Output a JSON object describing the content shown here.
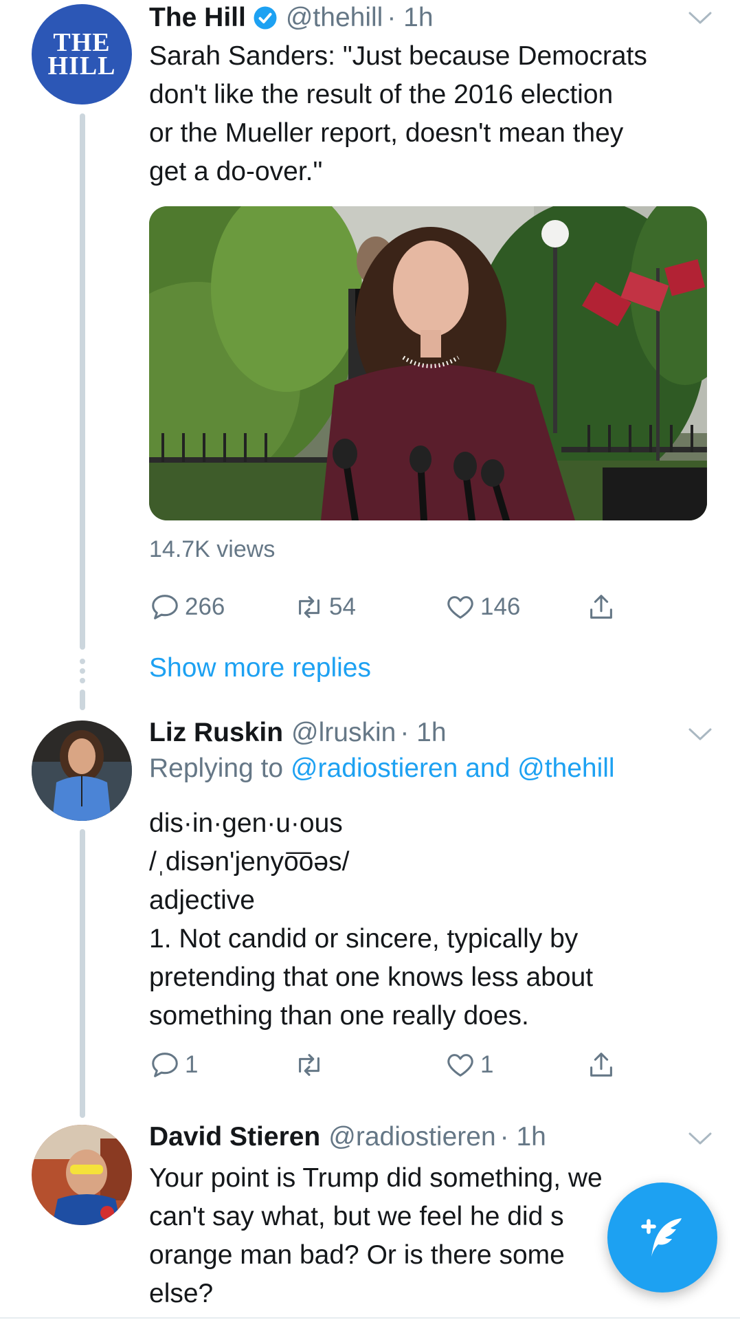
{
  "tweet1": {
    "author_name": "The Hill",
    "author_handle": "@thehill",
    "time": "· 1h",
    "avatar_text_line1": "THE",
    "avatar_text_line2": "HILL",
    "text_lines": [
      "Sarah Sanders: \"Just because Democrats",
      "don't like the result of the 2016 election",
      "or the Mueller report, doesn't mean they",
      "get a do-over.\""
    ],
    "views": "14.7K views",
    "reply_count": "266",
    "retweet_count": "54",
    "like_count": "146"
  },
  "show_more_replies": "Show more replies",
  "tweet2": {
    "author_name": "Liz Ruskin",
    "author_handle": "@lruskin",
    "time": "· 1h",
    "replying_prefix": "Replying to",
    "replying_user1": "@radiostieren",
    "replying_and": "and",
    "replying_user2": "@thehill",
    "text_lines": [
      "dis·in·gen·u·ous",
      "/ˌdisən'jenyo͞oəs/",
      "adjective",
      "1. Not candid or sincere, typically by",
      "pretending that one knows less about",
      "something than one really does."
    ],
    "reply_count": "1",
    "retweet_count": "",
    "like_count": "1"
  },
  "tweet3": {
    "author_name": "David Stieren",
    "author_handle": "@radiostieren",
    "time": "· 1h",
    "text_lines": [
      "Your point is Trump did something, we",
      "can't say what, but we feel he did s",
      "orange man bad? Or is there some",
      "else?"
    ]
  },
  "icons": {
    "verified": "verified-badge-icon",
    "caret": "chevron-down-icon",
    "reply": "reply-icon",
    "retweet": "retweet-icon",
    "like": "heart-icon",
    "share": "share-icon",
    "compose": "compose-tweet-icon"
  },
  "colors": {
    "link": "#1da1f2",
    "secondary_text": "#657786",
    "thread_line": "#ccd6dd",
    "hill_blue": "#2c57b6"
  }
}
